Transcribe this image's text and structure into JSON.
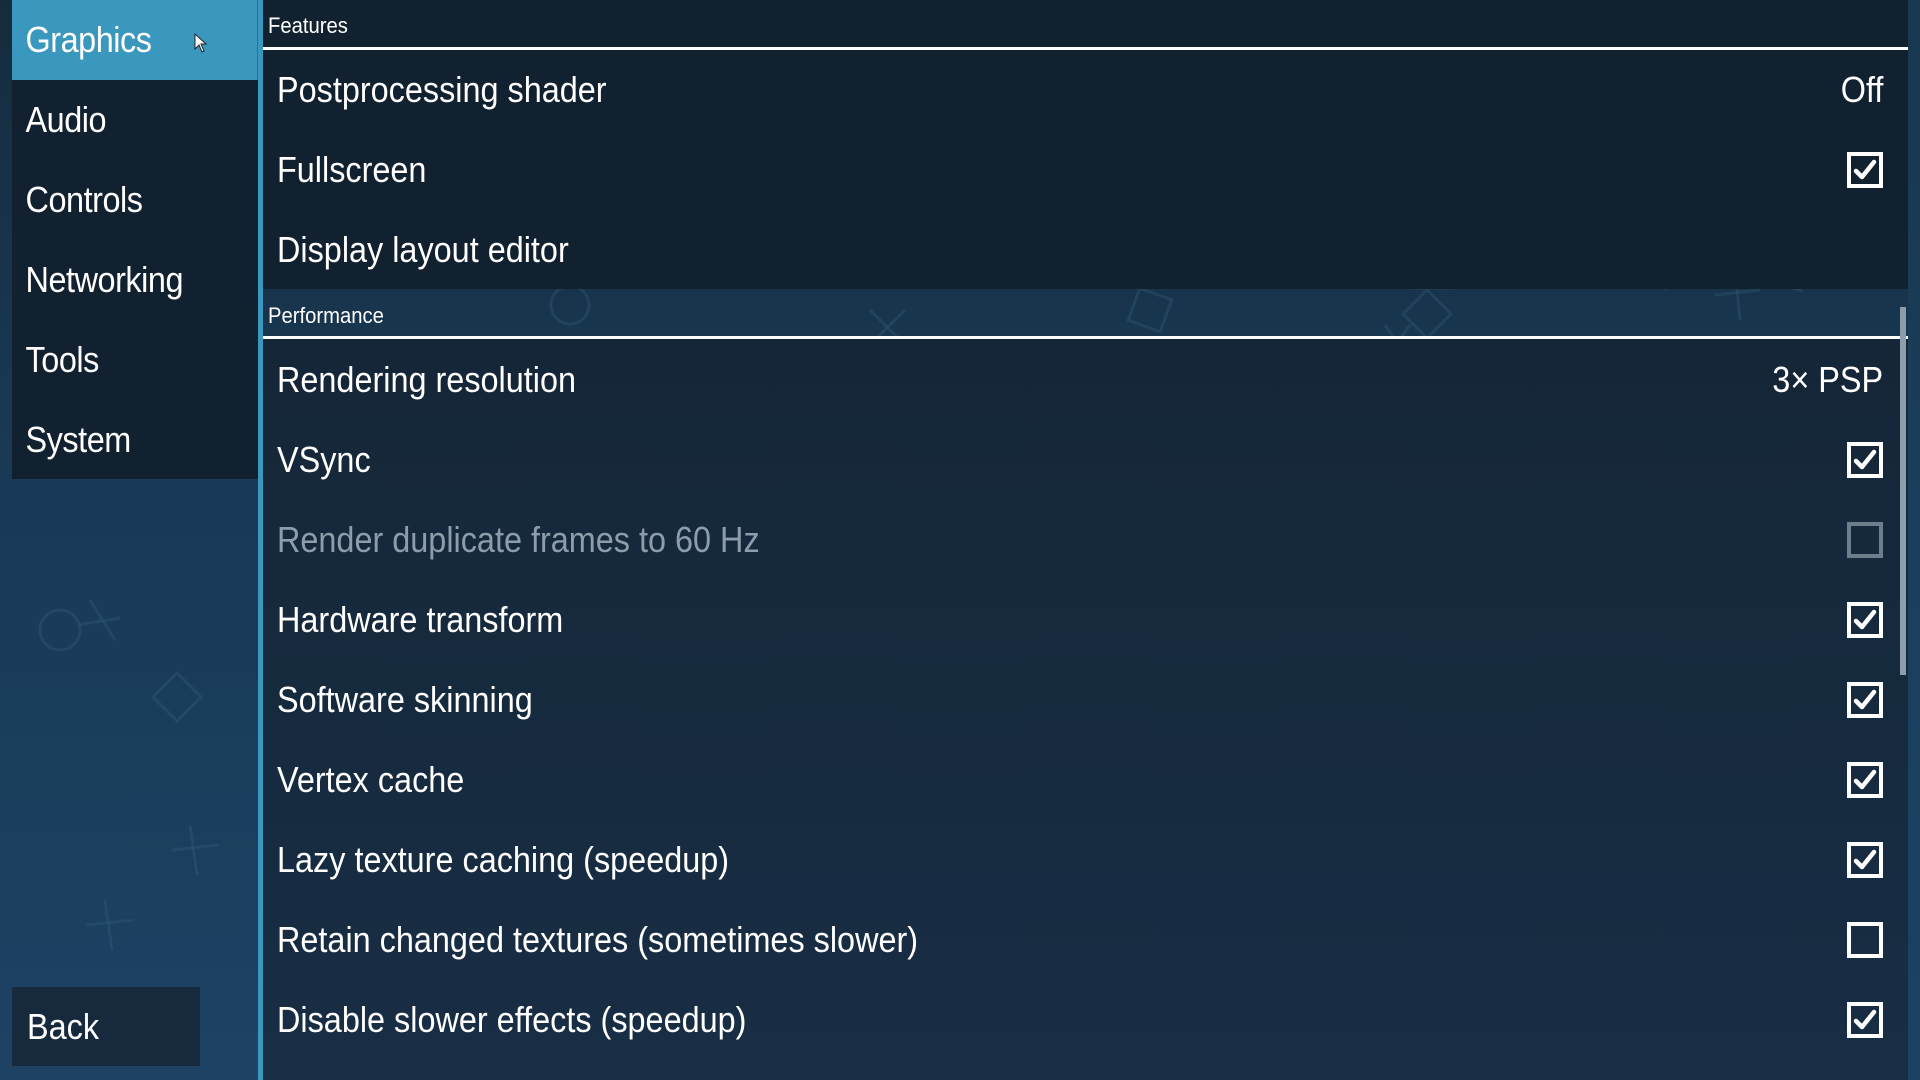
{
  "sidebar": {
    "items": [
      {
        "label": "Graphics",
        "active": true
      },
      {
        "label": "Audio",
        "active": false
      },
      {
        "label": "Controls",
        "active": false
      },
      {
        "label": "Networking",
        "active": false
      },
      {
        "label": "Tools",
        "active": false
      },
      {
        "label": "System",
        "active": false
      }
    ],
    "back_label": "Back"
  },
  "sections": {
    "features": {
      "title": "Features",
      "rows": [
        {
          "label": "Postprocessing shader",
          "type": "value",
          "value": "Off"
        },
        {
          "label": "Fullscreen",
          "type": "checkbox",
          "checked": true
        },
        {
          "label": "Display layout editor",
          "type": "action"
        }
      ]
    },
    "performance": {
      "title": "Performance",
      "rows": [
        {
          "label": "Rendering resolution",
          "type": "value",
          "value": "3× PSP"
        },
        {
          "label": "VSync",
          "type": "checkbox",
          "checked": true
        },
        {
          "label": "Render duplicate frames to 60 Hz",
          "type": "checkbox",
          "checked": false,
          "disabled": true
        },
        {
          "label": "Hardware transform",
          "type": "checkbox",
          "checked": true
        },
        {
          "label": "Software skinning",
          "type": "checkbox",
          "checked": true
        },
        {
          "label": "Vertex cache",
          "type": "checkbox",
          "checked": true
        },
        {
          "label": "Lazy texture caching (speedup)",
          "type": "checkbox",
          "checked": true
        },
        {
          "label": "Retain changed textures (sometimes slower)",
          "type": "checkbox",
          "checked": false
        },
        {
          "label": "Disable slower effects (speedup)",
          "type": "checkbox",
          "checked": true
        }
      ]
    }
  },
  "colors": {
    "accent": "#3a97be",
    "panel_dark": "#12212f",
    "disabled_text": "#8e9dab"
  },
  "icons": {
    "checkbox_checked": "checkmark-icon",
    "cursor": "mouse-pointer-icon"
  }
}
